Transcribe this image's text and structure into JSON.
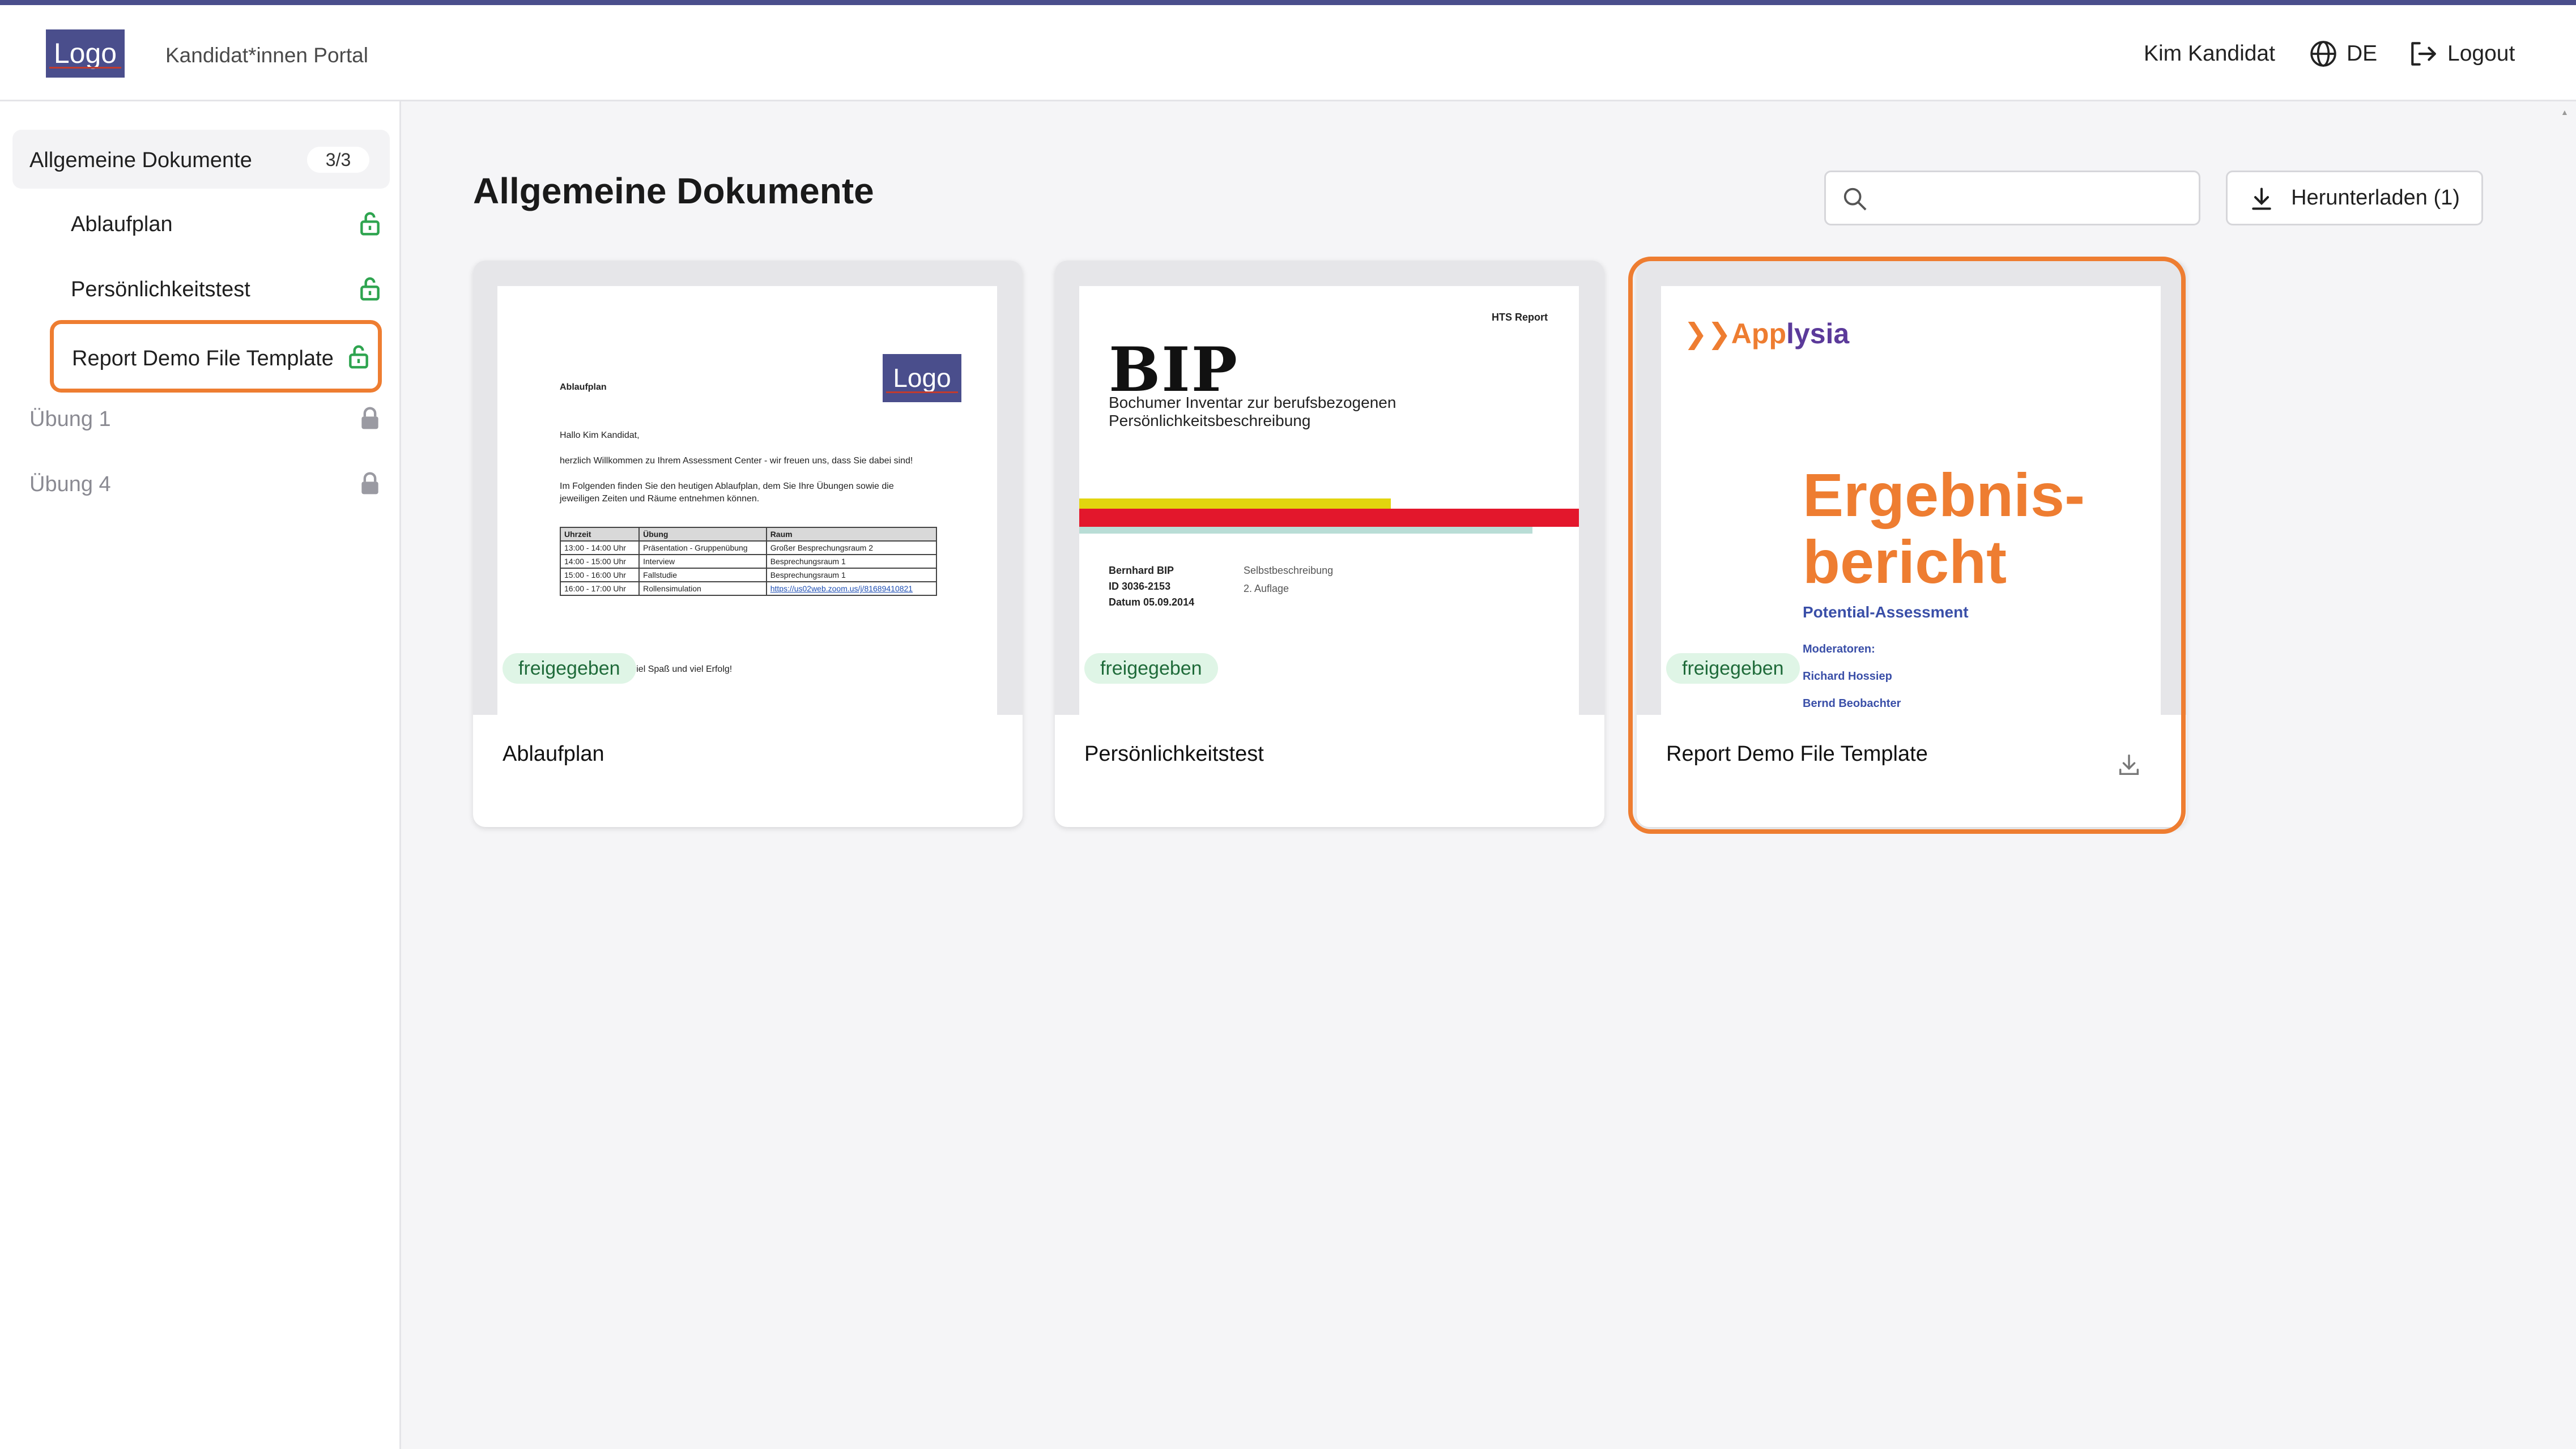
{
  "header": {
    "logo": "Logo",
    "portal_title": "Kandidat*innen Portal",
    "user_name": "Kim Kandidat",
    "language": "DE",
    "logout_label": "Logout"
  },
  "sidebar": {
    "group": {
      "label": "Allgemeine Dokumente",
      "count": "3/3"
    },
    "items": [
      {
        "label": "Ablaufplan",
        "icon": "unlock-icon",
        "color": "#2ea44f",
        "active": false
      },
      {
        "label": "Persönlichkeitstest",
        "icon": "unlock-icon",
        "color": "#2ea44f",
        "active": false
      },
      {
        "label": "Report Demo File Template",
        "icon": "unlock-icon",
        "color": "#2ea44f",
        "active": true
      },
      {
        "label": "Übung 1",
        "icon": "lock-icon",
        "color": "#9a9aa2",
        "active": false
      },
      {
        "label": "Übung 4",
        "icon": "lock-icon",
        "color": "#9a9aa2",
        "active": false
      }
    ]
  },
  "main": {
    "title": "Allgemeine Dokumente",
    "search": {
      "placeholder": "",
      "value": ""
    },
    "download_button": "Herunterladen (1)",
    "cards": [
      {
        "title": "Ablaufplan",
        "badge": "freigegeben"
      },
      {
        "title": "Persönlichkeitstest",
        "badge": "freigegeben"
      },
      {
        "title": "Report Demo File Template",
        "badge": "freigegeben"
      }
    ]
  },
  "thumb_ablaufplan": {
    "logo": "Logo",
    "heading": "Ablaufplan",
    "greeting": "Hallo Kim Kandidat,",
    "line1": "herzlich Willkommen zu Ihrem Assessment Center - wir freuen uns, dass Sie dabei sind!",
    "line2": "Im Folgenden finden Sie den heutigen Ablaufplan, dem Sie Ihre Übungen sowie die",
    "line3": "jeweiligen Zeiten und Räume entnehmen können.",
    "table_headers": [
      "Uhrzeit",
      "Übung",
      "Raum"
    ],
    "table_rows": [
      [
        "13:00 - 14:00 Uhr",
        "Präsentation - Gruppenübung",
        "Großer Besprechungsraum 2"
      ],
      [
        "14:00 - 15:00 Uhr",
        "Interview",
        "Besprechungsraum 1"
      ],
      [
        "15:00 - 16:00 Uhr",
        "Fallstudie",
        "Besprechungsraum 1"
      ],
      [
        "16:00 - 17:00 Uhr",
        "Rollensimulation",
        "https://us02web.zoom.us/j/81689410821"
      ]
    ],
    "closing": "en viel Spaß und viel Erfolg!"
  },
  "thumb_bip": {
    "report_label": "HTS Report",
    "title": "BIP",
    "subtitle1": "Bochumer Inventar zur berufsbezogenen",
    "subtitle2": "Persönlichkeitsbeschreibung",
    "name": "Bernhard BIP",
    "id": "ID 3036-2153",
    "date": "Datum 05.09.2014",
    "kind": "Selbstbeschreibung",
    "edition": "2. Auflage",
    "colors": {
      "yellow": "#e2d50e",
      "red": "#e3172c",
      "mint": "#b9ddd6"
    }
  },
  "thumb_report": {
    "brand_app": "App",
    "brand_rest": "lysia",
    "title_line1": "Ergebnis-",
    "title_line2": "bericht",
    "subtitle": "Potential-Assessment",
    "moderators_label": "Moderatoren:",
    "moderator1": "Richard Hossiep",
    "moderator2": "Bernd Beobachter"
  },
  "colors": {
    "accent_orange": "#ee7d31",
    "brand_navy": "#4a4e8c",
    "badge_bg": "#dff5e6",
    "badge_text": "#1f6b3a",
    "unlock_green": "#2ea44f",
    "lock_gray": "#9a9aa2"
  }
}
